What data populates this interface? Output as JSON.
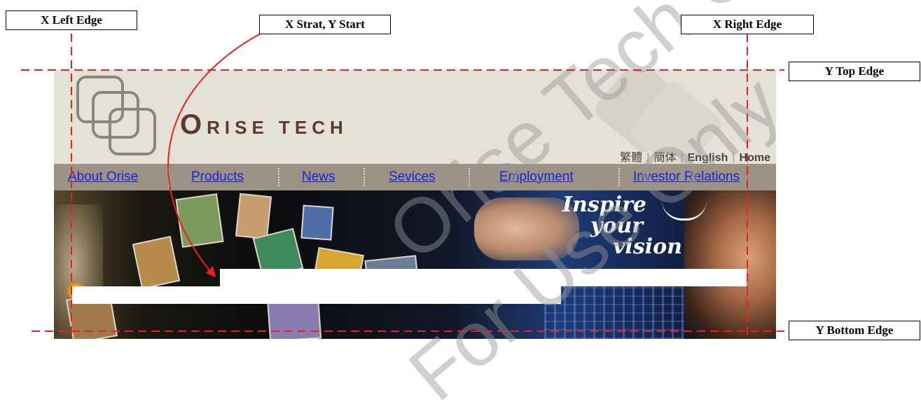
{
  "annotations": {
    "x_left_edge": "X Left Edge",
    "x_start_y_start": "X Strat, Y Start",
    "x_right_edge": "X Right Edge",
    "y_top_edge": "Y Top Edge",
    "y_bottom_edge": "Y Bottom Edge",
    "line_color": "#e8231c"
  },
  "site": {
    "brand": {
      "initial": "O",
      "rest": "RISE TECH"
    },
    "lang_links": [
      {
        "label": "繁體"
      },
      {
        "label": "簡体"
      },
      {
        "label": "English"
      },
      {
        "label": "Home"
      }
    ],
    "nav": [
      {
        "label": "About Orise"
      },
      {
        "label": "Products"
      },
      {
        "label": "News"
      },
      {
        "label": "Sevices"
      },
      {
        "label": "Employment"
      },
      {
        "label": "Investor Relations"
      }
    ],
    "banner_slogan": {
      "line1": "Inspire",
      "line2": "your",
      "line3": "vision"
    },
    "nav_link_color": "#1a25d4",
    "brand_color": "#5e3a2c"
  },
  "watermark": {
    "part1": "Orise Tech Confidential",
    "part2": "For Use Only"
  }
}
